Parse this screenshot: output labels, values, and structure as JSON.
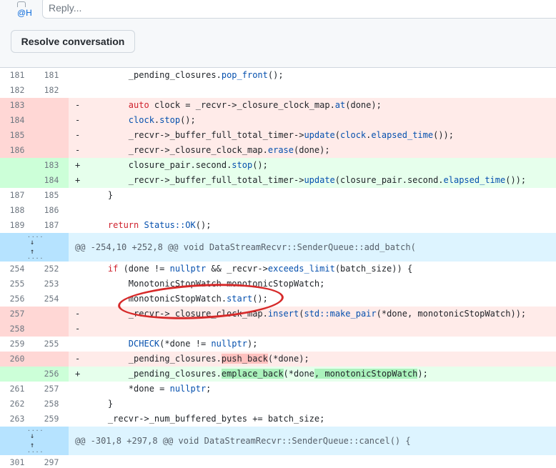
{
  "comment": {
    "avatar_alt": "@H",
    "reply_placeholder": "Reply...",
    "resolve_label": "Resolve conversation"
  },
  "diff": {
    "rows": [
      {
        "type": "ctx",
        "old": "181",
        "new": "181",
        "sign": "",
        "segments": [
          {
            "t": "        _pending_closures.",
            "c": ""
          },
          {
            "t": "pop_front",
            "c": "fn"
          },
          {
            "t": "();",
            "c": ""
          }
        ]
      },
      {
        "type": "ctx",
        "old": "182",
        "new": "182",
        "sign": "",
        "segments": [
          {
            "t": "",
            "c": ""
          }
        ]
      },
      {
        "type": "del",
        "old": "183",
        "new": "",
        "sign": "-",
        "segments": [
          {
            "t": "        ",
            "c": ""
          },
          {
            "t": "auto",
            "c": "kw"
          },
          {
            "t": " clock = _recvr->_closure_clock_map.",
            "c": ""
          },
          {
            "t": "at",
            "c": "fn"
          },
          {
            "t": "(done);",
            "c": ""
          }
        ]
      },
      {
        "type": "del",
        "old": "184",
        "new": "",
        "sign": "-",
        "segments": [
          {
            "t": "        ",
            "c": ""
          },
          {
            "t": "clock",
            "c": "fn"
          },
          {
            "t": ".",
            "c": ""
          },
          {
            "t": "stop",
            "c": "fn"
          },
          {
            "t": "();",
            "c": ""
          }
        ]
      },
      {
        "type": "del",
        "old": "185",
        "new": "",
        "sign": "-",
        "segments": [
          {
            "t": "        _recvr->_buffer_full_total_timer->",
            "c": ""
          },
          {
            "t": "update",
            "c": "fn"
          },
          {
            "t": "(",
            "c": ""
          },
          {
            "t": "clock",
            "c": "fn"
          },
          {
            "t": ".",
            "c": ""
          },
          {
            "t": "elapsed_time",
            "c": "fn"
          },
          {
            "t": "());",
            "c": ""
          }
        ]
      },
      {
        "type": "del",
        "old": "186",
        "new": "",
        "sign": "-",
        "segments": [
          {
            "t": "        _recvr->_closure_clock_map.",
            "c": ""
          },
          {
            "t": "erase",
            "c": "fn"
          },
          {
            "t": "(done);",
            "c": ""
          }
        ]
      },
      {
        "type": "add",
        "old": "",
        "new": "183",
        "sign": "+",
        "segments": [
          {
            "t": "        closure_pair.second.",
            "c": ""
          },
          {
            "t": "stop",
            "c": "fn"
          },
          {
            "t": "();",
            "c": ""
          }
        ]
      },
      {
        "type": "add",
        "old": "",
        "new": "184",
        "sign": "+",
        "segments": [
          {
            "t": "        _recvr->_buffer_full_total_timer->",
            "c": ""
          },
          {
            "t": "update",
            "c": "fn"
          },
          {
            "t": "(closure_pair.second.",
            "c": ""
          },
          {
            "t": "elapsed_time",
            "c": "fn"
          },
          {
            "t": "());",
            "c": ""
          }
        ]
      },
      {
        "type": "ctx",
        "old": "187",
        "new": "185",
        "sign": "",
        "segments": [
          {
            "t": "    }",
            "c": ""
          }
        ]
      },
      {
        "type": "ctx",
        "old": "188",
        "new": "186",
        "sign": "",
        "segments": [
          {
            "t": "",
            "c": ""
          }
        ]
      },
      {
        "type": "ctx",
        "old": "189",
        "new": "187",
        "sign": "",
        "segments": [
          {
            "t": "    ",
            "c": ""
          },
          {
            "t": "return",
            "c": "kw"
          },
          {
            "t": " ",
            "c": ""
          },
          {
            "t": "Status::OK",
            "c": "fn"
          },
          {
            "t": "();",
            "c": ""
          }
        ]
      },
      {
        "type": "hunk",
        "text": "@@ -254,10 +252,8 @@ void DataStreamRecvr::SenderQueue::add_batch("
      },
      {
        "type": "ctx",
        "old": "254",
        "new": "252",
        "sign": "",
        "segments": [
          {
            "t": "    ",
            "c": ""
          },
          {
            "t": "if",
            "c": "kw"
          },
          {
            "t": " (done != ",
            "c": ""
          },
          {
            "t": "nullptr",
            "c": "fn"
          },
          {
            "t": " && _recvr->",
            "c": ""
          },
          {
            "t": "exceeds_limit",
            "c": "fn"
          },
          {
            "t": "(batch_size)) {",
            "c": ""
          }
        ]
      },
      {
        "type": "ctx",
        "old": "255",
        "new": "253",
        "sign": "",
        "segments": [
          {
            "t": "        MonotonicStopWatch monotonicStopWatch;",
            "c": ""
          }
        ]
      },
      {
        "type": "ctx",
        "old": "256",
        "new": "254",
        "sign": "",
        "segments": [
          {
            "t": "        monotonicStopWatch.",
            "c": ""
          },
          {
            "t": "start",
            "c": "fn"
          },
          {
            "t": "();",
            "c": ""
          }
        ]
      },
      {
        "type": "del",
        "old": "257",
        "new": "",
        "sign": "-",
        "segments": [
          {
            "t": "        _recvr->_closure_clock_map.",
            "c": ""
          },
          {
            "t": "insert",
            "c": "fn"
          },
          {
            "t": "(",
            "c": ""
          },
          {
            "t": "std::make_pair",
            "c": "fn"
          },
          {
            "t": "(*done, monotonicStopWatch));",
            "c": ""
          }
        ]
      },
      {
        "type": "del",
        "old": "258",
        "new": "",
        "sign": "-",
        "segments": [
          {
            "t": "",
            "c": ""
          }
        ]
      },
      {
        "type": "ctx",
        "old": "259",
        "new": "255",
        "sign": "",
        "segments": [
          {
            "t": "        ",
            "c": ""
          },
          {
            "t": "DCHECK",
            "c": "fn"
          },
          {
            "t": "(*done != ",
            "c": ""
          },
          {
            "t": "nullptr",
            "c": "fn"
          },
          {
            "t": ");",
            "c": ""
          }
        ]
      },
      {
        "type": "del",
        "old": "260",
        "new": "",
        "sign": "-",
        "segments": [
          {
            "t": "        _pending_closures.",
            "c": ""
          },
          {
            "t": "push_back",
            "c": "hl-del"
          },
          {
            "t": "(*done);",
            "c": ""
          }
        ]
      },
      {
        "type": "add",
        "old": "",
        "new": "256",
        "sign": "+",
        "segments": [
          {
            "t": "        _pending_closures.",
            "c": ""
          },
          {
            "t": "emplace_back",
            "c": "hl-add"
          },
          {
            "t": "(*done",
            "c": ""
          },
          {
            "t": ", monotonicStopWatch",
            "c": "hl-add"
          },
          {
            "t": ");",
            "c": ""
          }
        ]
      },
      {
        "type": "ctx",
        "old": "261",
        "new": "257",
        "sign": "",
        "segments": [
          {
            "t": "        *done = ",
            "c": ""
          },
          {
            "t": "nullptr",
            "c": "fn"
          },
          {
            "t": ";",
            "c": ""
          }
        ]
      },
      {
        "type": "ctx",
        "old": "262",
        "new": "258",
        "sign": "",
        "segments": [
          {
            "t": "    }",
            "c": ""
          }
        ]
      },
      {
        "type": "ctx",
        "old": "263",
        "new": "259",
        "sign": "",
        "segments": [
          {
            "t": "    _recvr->_num_buffered_bytes += batch_size;",
            "c": ""
          }
        ]
      },
      {
        "type": "hunk",
        "text": "@@ -301,8 +297,8 @@ void DataStreamRecvr::SenderQueue::cancel() {"
      },
      {
        "type": "ctx",
        "old": "301",
        "new": "297",
        "sign": "",
        "segments": [
          {
            "t": "",
            "c": ""
          }
        ]
      }
    ]
  },
  "colors": {
    "deletion_bg": "#ffebe9",
    "addition_bg": "#e6ffec",
    "hunk_bg": "#ddf4ff",
    "annotation": "#d62a2a"
  }
}
